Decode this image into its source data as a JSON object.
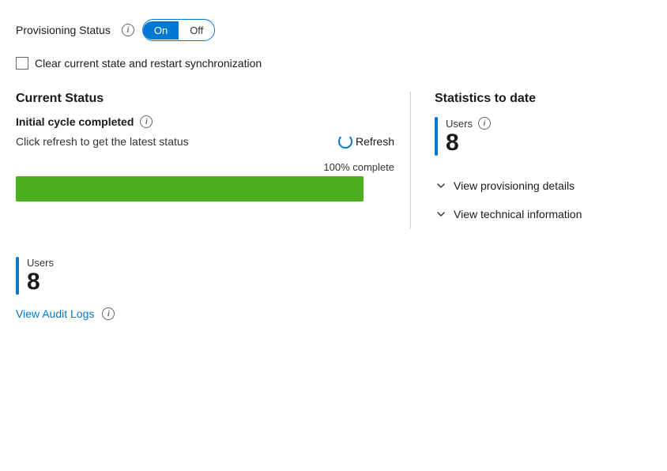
{
  "provisioning": {
    "label": "Provisioning Status",
    "toggle_on": "On",
    "toggle_off": "Off",
    "info_icon": "i"
  },
  "checkbox": {
    "label": "Clear current state and restart synchronization"
  },
  "current_status": {
    "section_title": "Current Status",
    "status_line": "Initial cycle completed",
    "refresh_hint": "Click refresh to get the latest status",
    "refresh_label": "Refresh",
    "progress_label": "100% complete",
    "progress_percent": 100
  },
  "statistics": {
    "section_title": "Statistics to date",
    "users_label": "Users",
    "users_value": "8"
  },
  "expand_items": [
    {
      "label": "View provisioning details"
    },
    {
      "label": "View technical information"
    }
  ],
  "bottom": {
    "users_label": "Users",
    "users_value": "8",
    "audit_link": "View Audit Logs"
  }
}
